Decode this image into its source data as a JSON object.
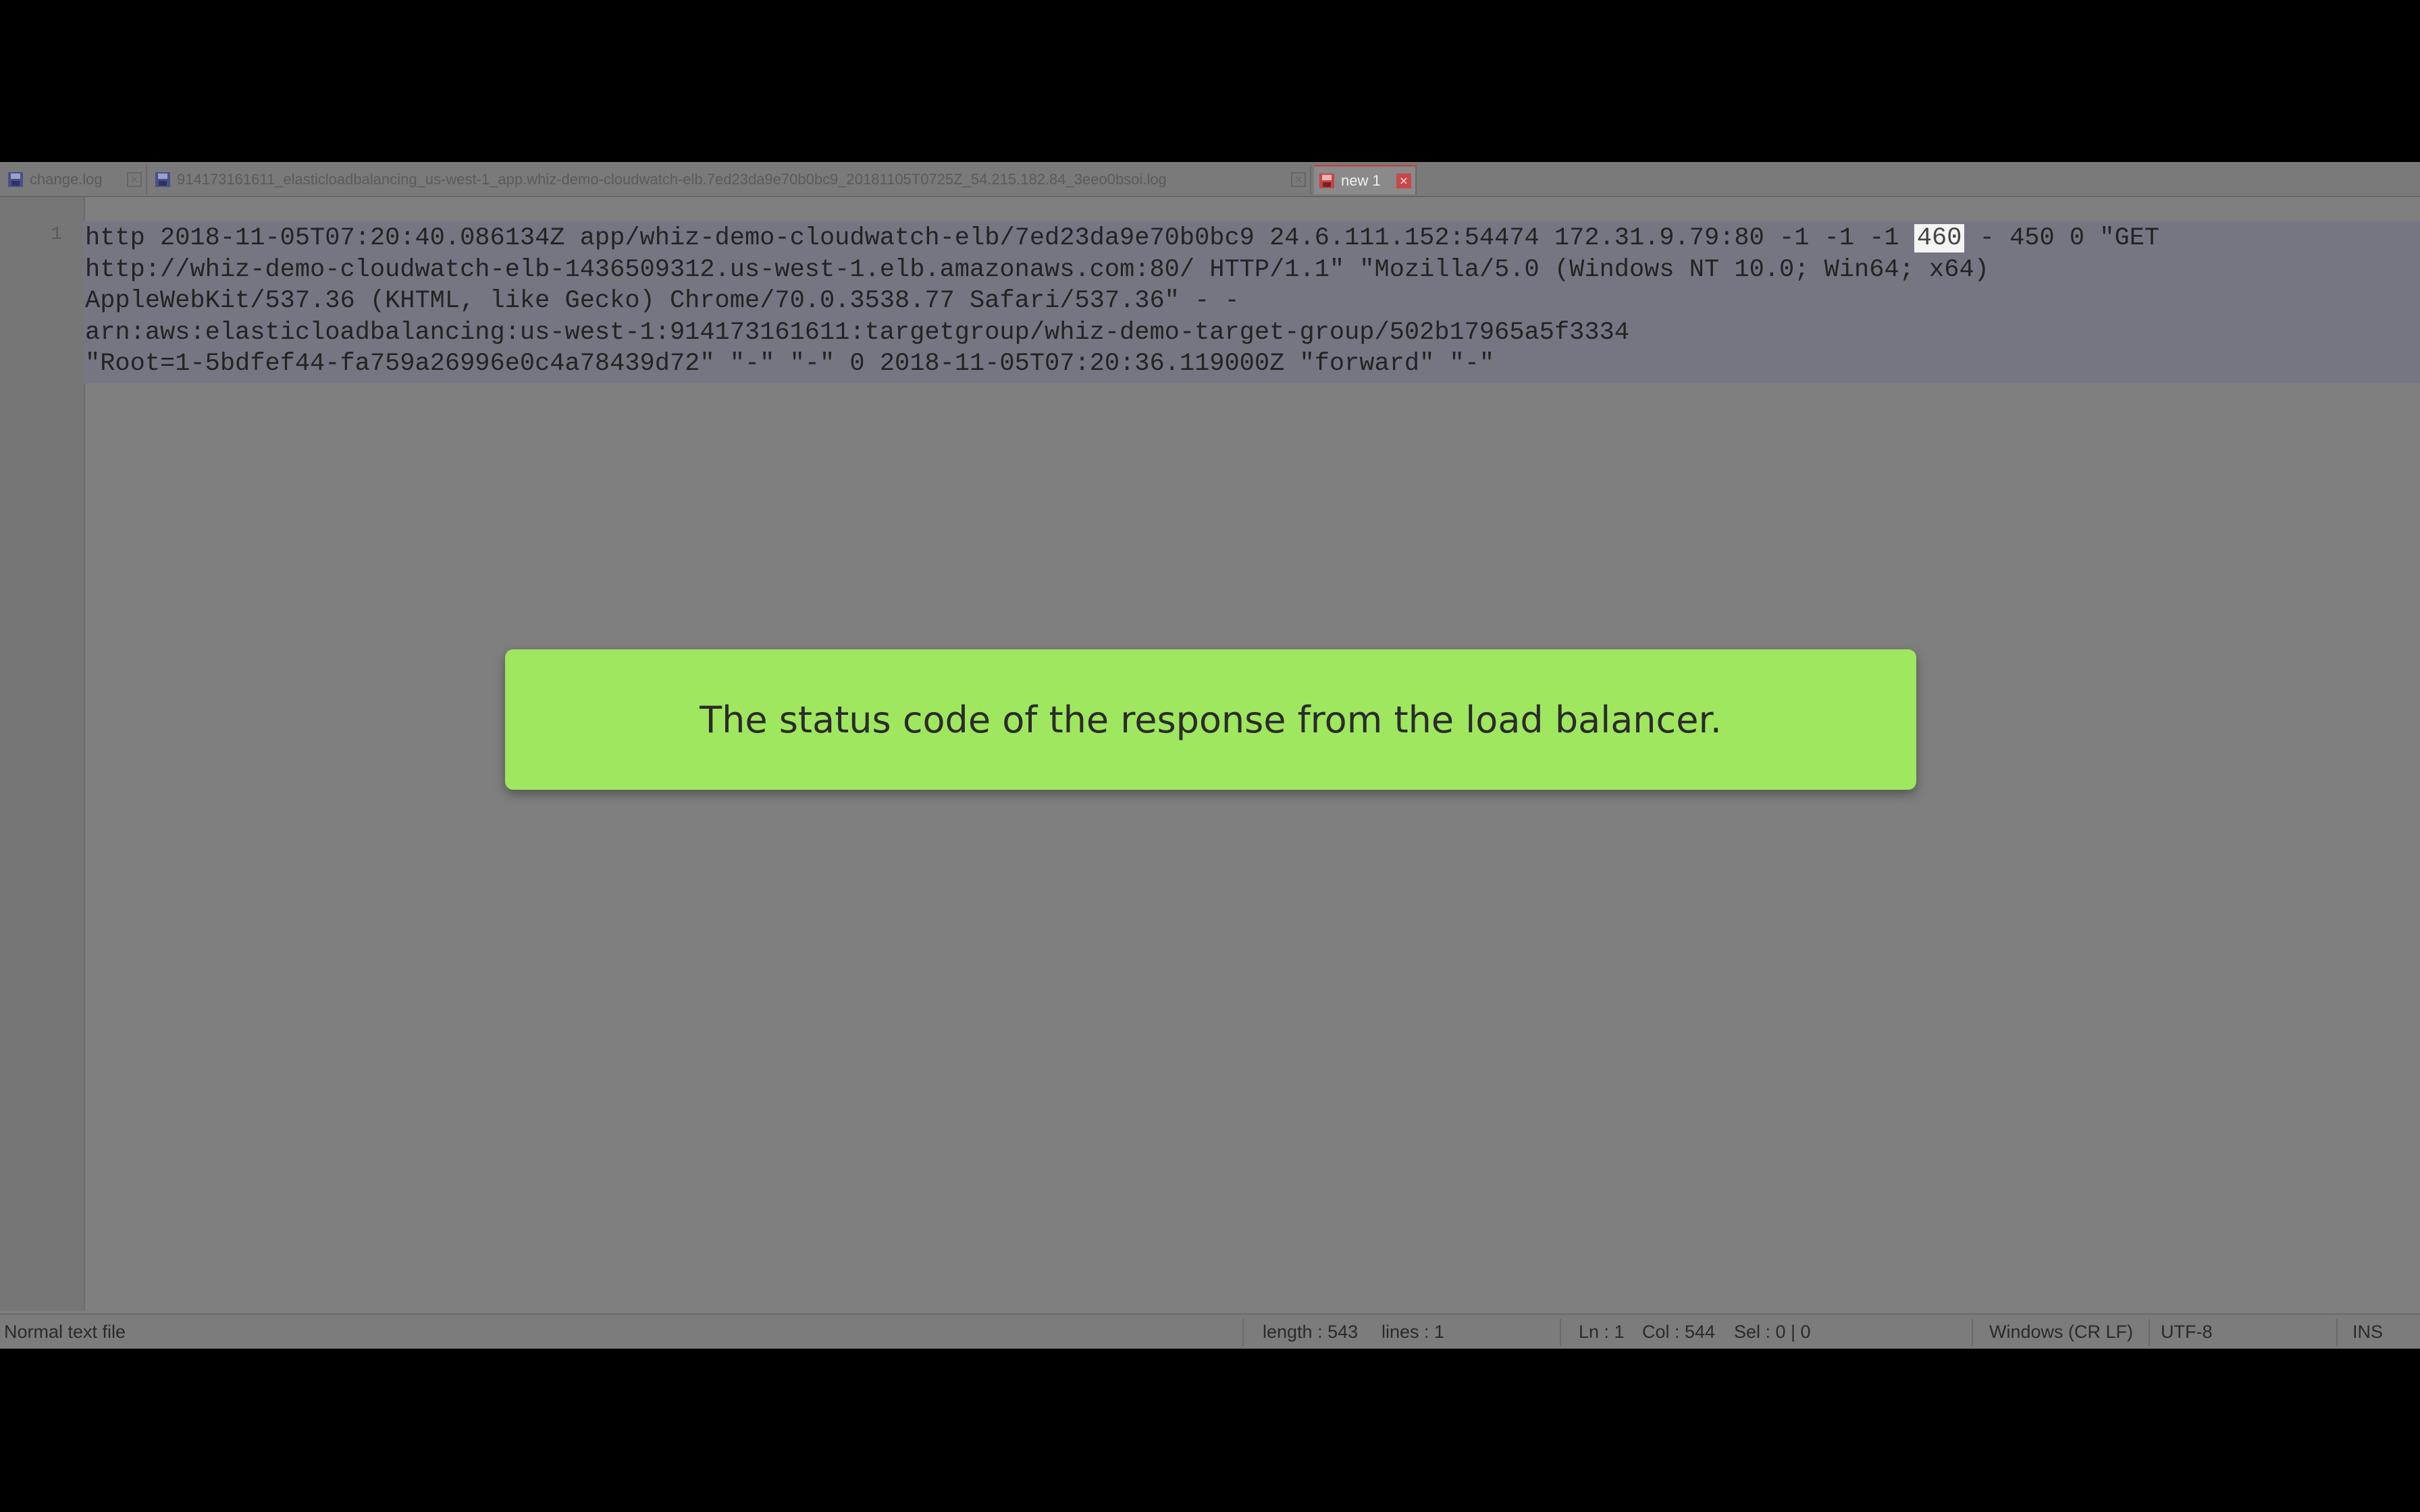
{
  "tabs": [
    {
      "label": "change.log",
      "active": false,
      "icon": "file-saved-icon"
    },
    {
      "label": "914173161611_elasticloadbalancing_us-west-1_app.whiz-demo-cloudwatch-elb.7ed23da9e70b0bc9_20181105T0725Z_54.215.182.84_3eeo0bsoi.log",
      "active": false,
      "icon": "file-saved-icon"
    },
    {
      "label": "new 1",
      "active": true,
      "icon": "file-unsaved-icon"
    }
  ],
  "editor": {
    "line_number": "1",
    "code_lines": {
      "l1_before": "http 2018-11-05T07:20:40.086134Z app/whiz-demo-cloudwatch-elb/7ed23da9e70b0bc9 24.6.111.152:54474 172.31.9.79:80 -1 -1 -1 ",
      "l1_highlight": "460",
      "l1_after": " - 450 0 \"GET",
      "l2": "http://whiz-demo-cloudwatch-elb-1436509312.us-west-1.elb.amazonaws.com:80/ HTTP/1.1\" \"Mozilla/5.0 (Windows NT 10.0; Win64; x64)",
      "l3": "AppleWebKit/537.36 (KHTML, like Gecko) Chrome/70.0.3538.77 Safari/537.36\" - -",
      "l4": "arn:aws:elasticloadbalancing:us-west-1:914173161611:targetgroup/whiz-demo-target-group/502b17965a5f3334",
      "l5": "\"Root=1-5bdfef44-fa759a26996e0c4a78439d72\" \"-\" \"-\" 0 2018-11-05T07:20:36.119000Z \"forward\" \"-\""
    }
  },
  "callout": {
    "text": "The status code of the response from the load balancer."
  },
  "statusbar": {
    "file_type": "Normal text file",
    "length": "length : 543",
    "lines": "lines : 1",
    "ln": "Ln : 1",
    "col": "Col : 544",
    "sel": "Sel : 0 | 0",
    "eol": "Windows (CR LF)",
    "encoding": "UTF-8",
    "mode": "INS"
  },
  "colors": {
    "callout_bg": "#9fe75f",
    "active_tab_close": "#c8484a",
    "selection_highlight": "#f4f4f4"
  }
}
